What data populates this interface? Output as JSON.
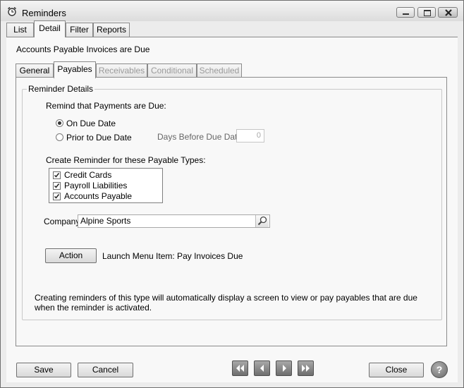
{
  "window": {
    "title": "Reminders"
  },
  "main_tabs": [
    "List",
    "Detail",
    "Filter",
    "Reports"
  ],
  "header": {
    "text": "Accounts Payable Invoices are Due"
  },
  "sub_tabs": [
    "General",
    "Payables",
    "Receivables",
    "Conditional",
    "Scheduled"
  ],
  "reminder_details": {
    "legend": "Reminder Details",
    "remind_label": "Remind that Payments are Due:",
    "radio_on_due": "On Due Date",
    "radio_prior": "Prior to Due Date",
    "selected_option": "On Due Date",
    "days_before_label": "Days Before Due Date",
    "days_before_value": "0",
    "types_label": "Create Reminder for these Payable Types:",
    "types": [
      {
        "label": "Credit Cards",
        "checked": true
      },
      {
        "label": "Payroll Liabilities",
        "checked": true
      },
      {
        "label": "Accounts Payable",
        "checked": true
      }
    ],
    "company_label": "Company",
    "company_value": "Alpine Sports",
    "action_button": "Action",
    "action_text": "Launch Menu Item: Pay Invoices Due",
    "description": "Creating reminders of this type will automatically display a screen to view or pay payables that are due when the reminder is activated."
  },
  "footer": {
    "save": "Save",
    "cancel": "Cancel",
    "close": "Close",
    "help": "?"
  },
  "icons": {
    "title": "alarm-clock-icon",
    "lookup": "magnifier-icon",
    "nav_first": "first-record-icon",
    "nav_prev": "previous-record-icon",
    "nav_next": "next-record-icon",
    "nav_last": "last-record-icon",
    "help": "help-icon"
  }
}
